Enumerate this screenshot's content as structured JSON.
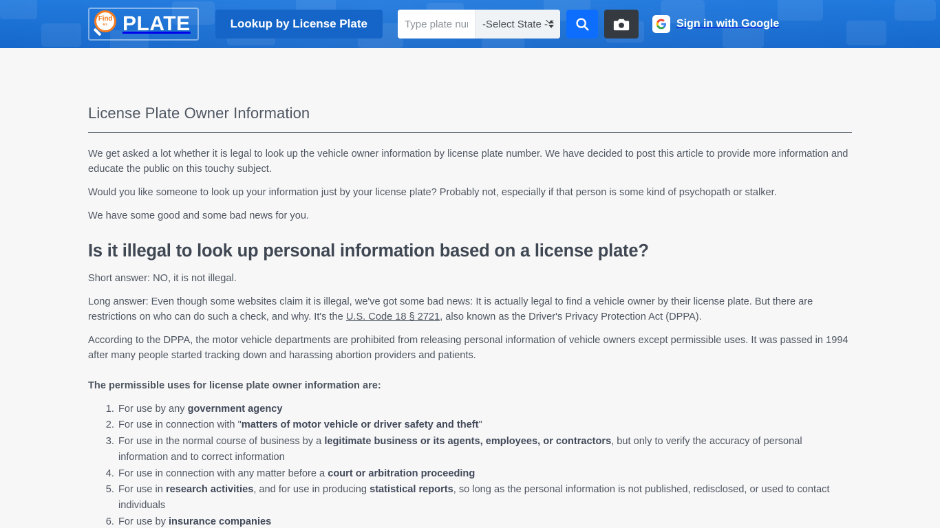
{
  "header": {
    "logo": {
      "mark_find": "Find",
      "mark_sub": "MY",
      "text": "PLATE",
      "name": "FindByPlate"
    },
    "lookup_button": "Lookup by License Plate",
    "plate_input": {
      "placeholder": "Type plate number",
      "value": ""
    },
    "state_select": {
      "selected": "-Select State -"
    },
    "search_button_icon": "search-icon",
    "camera_button_icon": "camera-icon",
    "google_signin": {
      "label": "Sign in with Google",
      "badge": "G"
    },
    "background_color": "#1a6fd4",
    "accent_color": "#0d6efd",
    "logo_accent_color": "#f47b20"
  },
  "article": {
    "title": "License Plate Owner Information",
    "paragraphs": [
      "We get asked a lot whether it is legal to look up the vehicle owner information by license plate number. We have decided to post this article to provide more information and educate the public on this touchy subject.",
      "Would you like someone to look up your information just by your license plate? Probably not, especially if that person is some kind of psychopath or stalker.",
      "We have some good and some bad news for you."
    ],
    "section_heading": "Is it illegal to look up personal information based on a license plate?",
    "short_answer": "Short answer: NO, it is not illegal.",
    "long_answer": {
      "before_link": "Long answer: Even though some websites claim it is illegal, we've got some bad news: It is actually legal to find a vehicle owner by their license plate. But there are restrictions on who can do such a check, and why. It's the ",
      "link_text": "U.S. Code 18 § 2721",
      "after_link": ", also known as the Driver's Privacy Protection Act (DPPA)."
    },
    "dppa_paragraph": "According to the DPPA, the motor vehicle departments are prohibited from releasing personal information of vehicle owners except permissible uses. It was passed in 1994 after many people started tracking down and harassing abortion providers and patients.",
    "list_intro": "The permissible uses for license plate owner information are:",
    "uses": [
      {
        "before": "For use by any ",
        "bold": "government agency",
        "after": ""
      },
      {
        "before": "For use in connection with \"",
        "bold": "matters of motor vehicle or driver safety and theft",
        "after": "\""
      },
      {
        "before": "For use in the normal course of business by a ",
        "bold": "legitimate business or its agents, employees, or contractors",
        "after": ", but only to verify the accuracy of personal information and to correct information"
      },
      {
        "before": "For use in connection with any matter before a ",
        "bold": "court or arbitration proceeding",
        "after": ""
      },
      {
        "before": "For use in ",
        "bold": "research activities",
        "bold2": "statistical reports",
        "middle": ", and for use in producing ",
        "after": ", so long as the personal information is not published, redisclosed, or used to contact individuals"
      },
      {
        "before": "For use by ",
        "bold": "insurance companies",
        "after": ""
      }
    ],
    "text_color": "#4e5661"
  }
}
